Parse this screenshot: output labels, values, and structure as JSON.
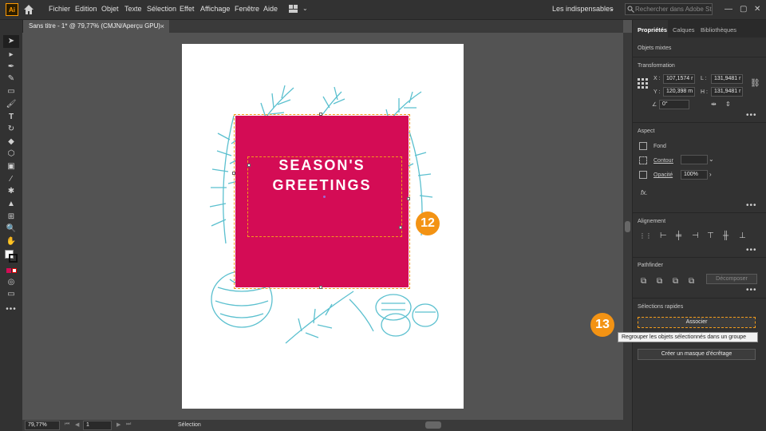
{
  "app": {
    "logo": "Ai"
  },
  "menu": [
    "Fichier",
    "Edition",
    "Objet",
    "Texte",
    "Sélection",
    "Effet",
    "Affichage",
    "Fenêtre",
    "Aide"
  ],
  "workspace": "Les indispensables",
  "search": {
    "placeholder": "Rechercher dans Adobe Stock"
  },
  "document_tab": {
    "title": "Sans titre - 1* @ 79,77% (CMJN/Aperçu GPU)",
    "close": "×"
  },
  "artwork": {
    "line1": "SEASON'S",
    "line2": "GREETINGS"
  },
  "badges": {
    "b12": "12",
    "b13": "13"
  },
  "status": {
    "zoom": "79,77%",
    "page": "1",
    "tool": "Sélection"
  },
  "panel": {
    "tabs": [
      "Propriétés",
      "Calques",
      "Bibliothèques"
    ],
    "object_type": "Objets mixtes",
    "transformation": {
      "title": "Transformation",
      "x_label": "X :",
      "x": "107,1574 r",
      "y_label": "Y :",
      "y": "120,398 m",
      "w_label": "L :",
      "w": "131,9481 r",
      "h_label": "H :",
      "h": "131,9481 r",
      "angle": "0°"
    },
    "aspect": {
      "title": "Aspect",
      "fill": "Fond",
      "stroke": "Contour",
      "opacity_label": "Opacité",
      "opacity": "100%",
      "fx": "fx."
    },
    "alignment": {
      "title": "Alignement"
    },
    "pathfinder": {
      "title": "Pathfinder",
      "button": "Décomposer"
    },
    "quick": {
      "title": "Sélections rapides",
      "group_button": "Associer",
      "tooltip": "Regrouper les objets sélectionnés dans un groupe",
      "clip_button": "Créer un masque d'écrêtage"
    },
    "more": "•••"
  },
  "colors": {
    "accent_red": "#d40c55",
    "leaf_teal": "#5bc0cf",
    "badge_orange": "#f39314",
    "selection_orange": "#f29b1a"
  }
}
